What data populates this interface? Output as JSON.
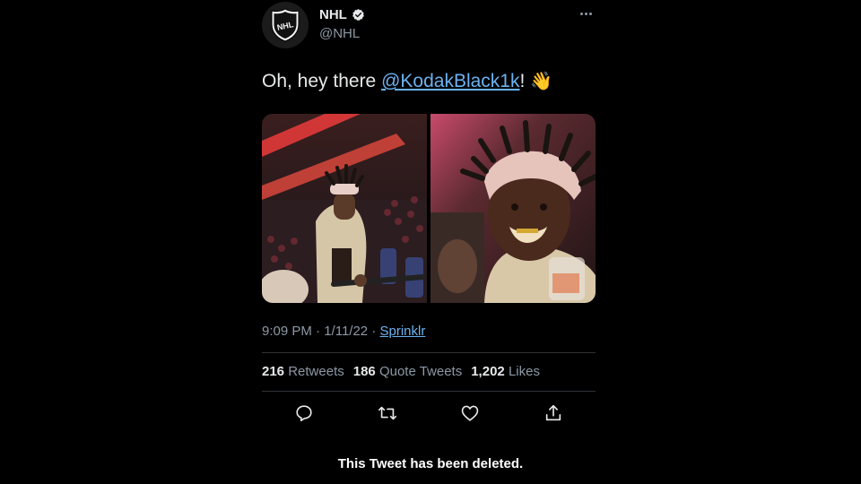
{
  "account": {
    "display_name": "NHL",
    "handle": "@NHL",
    "avatar_icon": "nhl-shield-logo",
    "avatar_text": "NHL",
    "verified": true
  },
  "tweet": {
    "text_before": "Oh, hey there ",
    "mention": "@KodakBlack1k",
    "text_after": "! ",
    "emoji": "👋",
    "photos": [
      {
        "icon": "photo-arena-person"
      },
      {
        "icon": "photo-closeup-smile"
      }
    ],
    "time": "9:09 PM",
    "separator": "·",
    "date": "1/11/22",
    "source": "Sprinklr"
  },
  "stats": {
    "retweets_count": "216",
    "retweets_label": "Retweets",
    "quotes_count": "186",
    "quotes_label": "Quote Tweets",
    "likes_count": "1,202",
    "likes_label": "Likes"
  },
  "actions": [
    {
      "icon": "reply-icon"
    },
    {
      "icon": "retweet-icon"
    },
    {
      "icon": "like-icon"
    },
    {
      "icon": "share-icon"
    }
  ],
  "caption": "This Tweet has been deleted.",
  "colors": {
    "background": "#000000",
    "text": "#e7e9ea",
    "muted": "#8b98a5",
    "link": "#6cb2f0",
    "divider": "#2f3336"
  }
}
